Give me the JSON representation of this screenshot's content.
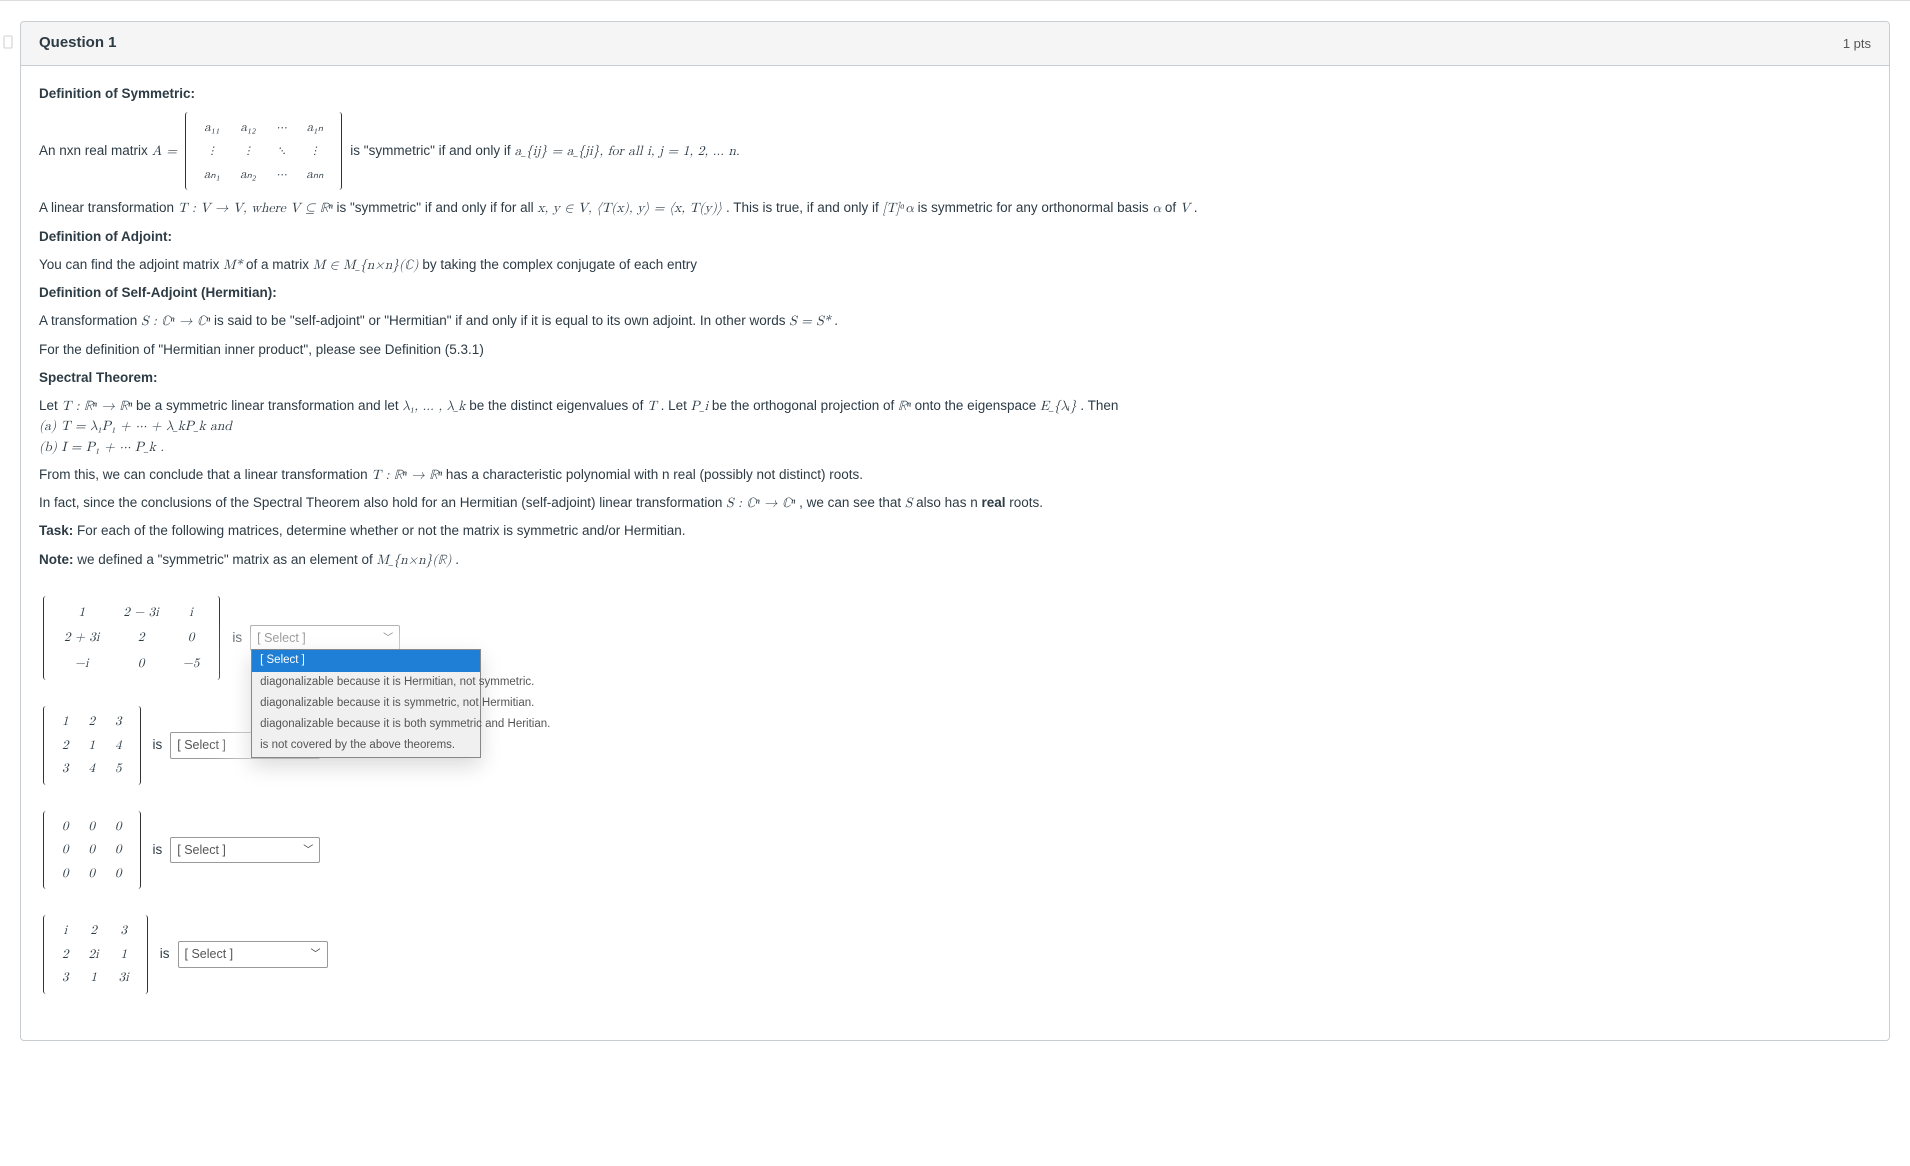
{
  "header": {
    "title": "Question 1",
    "points": "1 pts"
  },
  "defs": {
    "symmetric_heading": "Definition of Symmetric:",
    "nxn_prefix": "An nxn real matrix ",
    "A_eq": "A =",
    "symmetric_cond": " is \"symmetric\" if and only if ",
    "aij_eq": "a_{ij} = a_{ji},  for all i, j = 1, 2, … n.",
    "linear_trans_1": "A linear transformation ",
    "linear_trans_math1": "T : V → V,  where V ⊆ ℝⁿ",
    "linear_trans_2": " is \"symmetric\" if and only if for all ",
    "linear_trans_math2": "x, y ∈ V, ⟨T(x), y⟩ = ⟨x, T(y)⟩",
    "linear_trans_3": ". This is true, if and only if ",
    "linear_trans_math3": "[T]ᵅα",
    "linear_trans_4": " is symmetric for any orthonormal basis ",
    "linear_trans_math4": "α",
    "linear_trans_5": " of ",
    "linear_trans_math5": "V",
    "linear_trans_6": ".",
    "adjoint_heading": "Definition of Adjoint:",
    "adjoint_text_1": "You can find the adjoint matrix ",
    "adjoint_math1": "M*",
    "adjoint_text_2": " of a matrix ",
    "adjoint_math2": "M ∈ M_{n×n}(ℂ)",
    "adjoint_text_3": " by taking the complex conjugate of each entry",
    "selfadj_heading": "Definition of Self-Adjoint (Hermitian):",
    "selfadj_text_1": "A transformation ",
    "selfadj_math1": "S : ℂⁿ → ℂⁿ",
    "selfadj_text_2": " is said to be \"self-adjoint\" or \"Hermitian\" if and only if it is equal to its own adjoint. In other words ",
    "selfadj_math2": "S = S*",
    "selfadj_text_3": ".",
    "herm_ref": "For the definition of \"Hermitian inner product\", please see Definition (5.3.1)",
    "spectral_heading": "Spectral Theorem:",
    "spectral_text_1a": "Let ",
    "spectral_math_1a": "T : ℝⁿ → ℝⁿ",
    "spectral_text_1b": " be a symmetric linear transformation and let ",
    "spectral_math_1b": "λ₁, … , λ_k",
    "spectral_text_1c": " be the distinct eigenvalues of ",
    "spectral_math_1c": "T",
    "spectral_text_1d": ". Let ",
    "spectral_math_1d": "P_i",
    "spectral_text_1e": " be the orthogonal projection of ",
    "spectral_math_1e": "ℝⁿ",
    "spectral_text_1f": " onto the eigenspace ",
    "spectral_math_1f": "E_{λᵢ}",
    "spectral_text_1g": ". Then",
    "spectral_a": "(a) T = λ₁P₁ + ··· + λ_kP_k  and",
    "spectral_b": "(b) I = P₁ + ··· P_k .",
    "from_this_1": "From this, we can conclude that a linear transformation ",
    "from_this_math": "T : ℝⁿ → ℝⁿ",
    "from_this_2": " has a characteristic polynomial with n real (possibly not distinct) roots.",
    "infact_1": "In fact, since the conclusions of the Spectral Theorem also hold for an Hermitian (self-adjoint) linear transformation ",
    "infact_math": "S : ℂⁿ → ℂⁿ",
    "infact_2": ", we can see that ",
    "infact_math2": "S",
    "infact_3": " also has n ",
    "infact_bold": "real",
    "infact_4": " roots.",
    "task_label": "Task:",
    "task_text": " For each of the following matrices, determine whether or not the matrix is symmetric and/or Hermitian.",
    "note_label": "Note:",
    "note_text_1": " we defined a \"symmetric\" matrix as an element of ",
    "note_math": "M_{n×n}(ℝ)",
    "note_text_2": "."
  },
  "matrix_a_entries": {
    "r0c0": "a₁₁",
    "r0c1": "a₁₂",
    "r0c2": "⋯",
    "r0c3": "a₁ₙ",
    "r1c0": "⋮",
    "r1c1": "⋮",
    "r1c2": "⋱",
    "r1c3": "⋮",
    "r2c0": "aₙ₁",
    "r2c1": "aₙ₂",
    "r2c2": "⋯",
    "r2c3": "aₙₙ"
  },
  "matrices": [
    {
      "rows": [
        [
          "1",
          "2 − 3i",
          "i"
        ],
        [
          "2 + 3i",
          "2",
          "0"
        ],
        [
          "−i",
          "0",
          "−5"
        ]
      ]
    },
    {
      "rows": [
        [
          "1",
          "2",
          "3"
        ],
        [
          "2",
          "1",
          "4"
        ],
        [
          "3",
          "4",
          "5"
        ]
      ]
    },
    {
      "rows": [
        [
          "0",
          "0",
          "0"
        ],
        [
          "0",
          "0",
          "0"
        ],
        [
          "0",
          "0",
          "0"
        ]
      ]
    },
    {
      "rows": [
        [
          "i",
          "2",
          "3"
        ],
        [
          "2",
          "2i",
          "1"
        ],
        [
          "3",
          "1",
          "3i"
        ]
      ]
    }
  ],
  "is_label": "is",
  "select_placeholder": "[ Select ]",
  "dropdown_options": [
    "[ Select ]",
    "diagonalizable because it is Hermitian, not symmetric.",
    "diagonalizable because it is symmetric, not Hermitian.",
    "diagonalizable because it is both symmetric and Heritian.",
    "is not covered by the above theorems."
  ]
}
